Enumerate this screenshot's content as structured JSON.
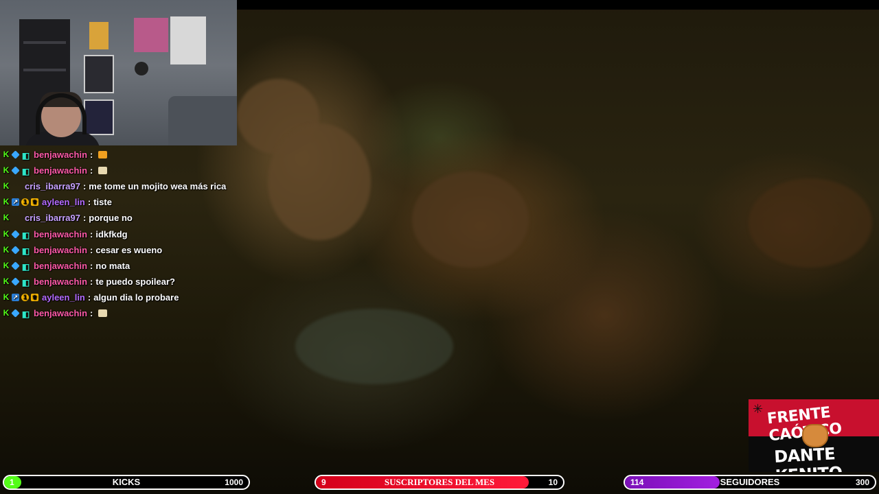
{
  "chat": {
    "messages": [
      {
        "user": "benjawachin",
        "text": "",
        "user_color": "#ff5aa8",
        "badges": [
          "kick-icon",
          "cube-icon",
          "glyph-icon"
        ],
        "emote": "fist-emote"
      },
      {
        "user": "benjawachin",
        "text": "",
        "user_color": "#ff5aa8",
        "badges": [
          "kick-icon",
          "cube-icon",
          "glyph-icon"
        ],
        "emote": "paper-emote"
      },
      {
        "user": "cris_ibarra97",
        "text": "me tome un mojito wea más rica",
        "user_color": "#c7a2ff",
        "badges": [
          "kick-icon"
        ],
        "emote": ""
      },
      {
        "user": "ayleen_lin",
        "text": "tiste",
        "user_color": "#b36bff",
        "badges": [
          "kick-icon",
          "boost-icon",
          "sub-icon",
          "crown-icon"
        ],
        "emote": ""
      },
      {
        "user": "cris_ibarra97",
        "text": "porque no",
        "user_color": "#c7a2ff",
        "badges": [
          "kick-icon"
        ],
        "emote": ""
      },
      {
        "user": "benjawachin",
        "text": "idkfkdg",
        "user_color": "#ff5aa8",
        "badges": [
          "kick-icon",
          "cube-icon",
          "glyph-icon"
        ],
        "emote": ""
      },
      {
        "user": "benjawachin",
        "text": "cesar es wueno",
        "user_color": "#ff5aa8",
        "badges": [
          "kick-icon",
          "cube-icon",
          "glyph-icon"
        ],
        "emote": ""
      },
      {
        "user": "benjawachin",
        "text": "no mata",
        "user_color": "#ff5aa8",
        "badges": [
          "kick-icon",
          "cube-icon",
          "glyph-icon"
        ],
        "emote": ""
      },
      {
        "user": "benjawachin",
        "text": "te puedo spoilear?",
        "user_color": "#ff5aa8",
        "badges": [
          "kick-icon",
          "cube-icon",
          "glyph-icon"
        ],
        "emote": ""
      },
      {
        "user": "ayleen_lin",
        "text": "algun dia lo probare",
        "user_color": "#b36bff",
        "badges": [
          "kick-icon",
          "boost-icon",
          "sub-icon",
          "crown-icon"
        ],
        "emote": ""
      },
      {
        "user": "benjawachin",
        "text": "",
        "user_color": "#ff5aa8",
        "badges": [
          "kick-icon",
          "cube-icon",
          "glyph-icon"
        ],
        "emote": "paper-emote"
      }
    ],
    "separator": ":",
    "sub_badge_text": "1"
  },
  "logo": {
    "line1": "FRENTE CAÓTICO",
    "line2": "DANTE KENITO"
  },
  "goals": {
    "kicks": {
      "current": "1",
      "label": "KICKS",
      "target": "1000",
      "progress": 0.001,
      "color": "#53fc18"
    },
    "subs": {
      "current": "9",
      "label": "SUSCRIPTORES DEL MES",
      "target": "10",
      "progress": 0.9,
      "color": "#e5102b"
    },
    "followers": {
      "current": "114",
      "label": "SEGUIDORES",
      "target": "300",
      "progress": 0.38,
      "color": "#8e17cc"
    }
  }
}
